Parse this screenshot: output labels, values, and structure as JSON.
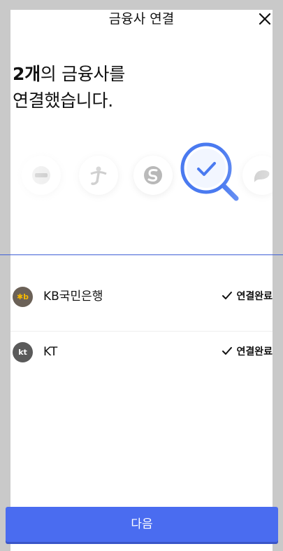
{
  "header": {
    "title": "금융사 연결",
    "close_icon": "close-icon"
  },
  "headline": {
    "count": "2개",
    "line1_rest": "의 금융사를",
    "line2": "연결했습니다."
  },
  "logos": {
    "items": [
      "bank-logo-icon",
      "hana-logo-icon",
      "shinhan-logo-icon",
      "search-check-icon",
      "bank-logo-icon"
    ],
    "accent": "#4a7af0"
  },
  "connections": [
    {
      "name": "KB국민은행",
      "icon": "kb-logo-icon",
      "icon_text": "✱b",
      "icon_color": "#6b6157",
      "status": "연결완료"
    },
    {
      "name": "KT",
      "icon": "kt-logo-icon",
      "icon_text": "kt",
      "icon_color": "#5a5a5a",
      "status": "연결완료"
    }
  ],
  "footer": {
    "next_label": "다음",
    "button_color": "#4a6cf0"
  }
}
